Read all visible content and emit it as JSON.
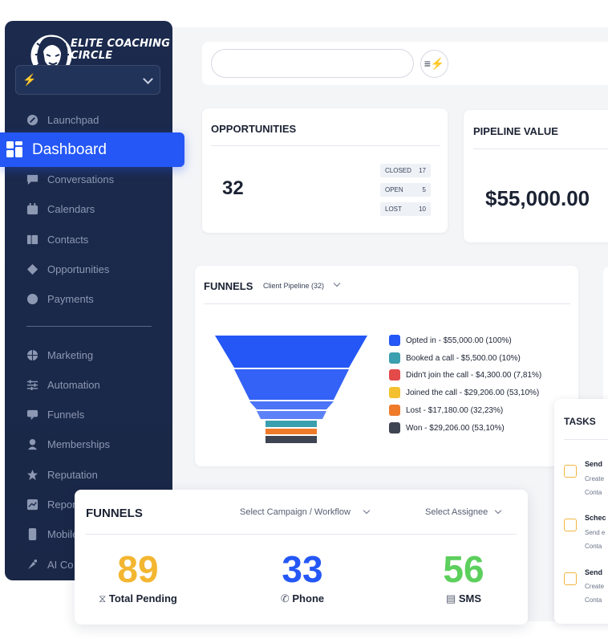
{
  "brand": {
    "name_line1": "ELITE COACHING",
    "name_line2": "CIRCLE"
  },
  "colors": {
    "accent": "#2457f5",
    "sidebar": "#1b2a4d",
    "orange": "#f3b630",
    "blue": "#2457f5",
    "green": "#5ccf5c"
  },
  "sidebar": {
    "items": [
      {
        "label": "Launchpad",
        "icon": "rocket-icon"
      },
      {
        "label": "Dashboard",
        "icon": "grid-icon",
        "active": true
      },
      {
        "label": "Conversations",
        "icon": "chat-icon"
      },
      {
        "label": "Calendars",
        "icon": "calendar-icon"
      },
      {
        "label": "Contacts",
        "icon": "contacts-icon"
      },
      {
        "label": "Opportunities",
        "icon": "opportunities-icon"
      },
      {
        "label": "Payments",
        "icon": "payments-icon"
      },
      {
        "label": "Marketing",
        "icon": "globe-icon"
      },
      {
        "label": "Automation",
        "icon": "sliders-icon"
      },
      {
        "label": "Funnels",
        "icon": "funnel-icon"
      },
      {
        "label": "Memberships",
        "icon": "membership-icon"
      },
      {
        "label": "Reputation",
        "icon": "star-icon"
      },
      {
        "label": "Repor",
        "icon": "reporting-icon"
      },
      {
        "label": "Mobile",
        "icon": "mobile-icon"
      },
      {
        "label": "AI Co",
        "icon": "ai-icon"
      }
    ]
  },
  "opportunities": {
    "title": "OPPORTUNITIES",
    "total": "32",
    "pills": [
      {
        "label": "CLOSED",
        "value": "17"
      },
      {
        "label": "OPEN",
        "value": "5"
      },
      {
        "label": "LOST",
        "value": "10"
      }
    ]
  },
  "pipeline": {
    "title": "PIPELINE VALUE",
    "value": "$55,000.00"
  },
  "funnels_chart": {
    "title": "FUNNELS",
    "selector": "Client Pipeline (32)",
    "legend": [
      {
        "label": "Opted in - $55,000.00 (100%)",
        "color": "#2457f5"
      },
      {
        "label": "Booked a call - $5,500.00 (10%)",
        "color": "#3a9fae"
      },
      {
        "label": "Didn't join the call - $4,300.00 (7,81%)",
        "color": "#e34a4a"
      },
      {
        "label": "Joined the call - $29,206.00 (53,10%)",
        "color": "#f3c130"
      },
      {
        "label": "Lost - $17,180.00 (32,23%)",
        "color": "#ef7a2a"
      },
      {
        "label": "Won - $29,206.00 (53,10%)",
        "color": "#3f4452"
      }
    ]
  },
  "tasks": {
    "title": "TASKS",
    "items": [
      {
        "title": "Send",
        "line1": "Create",
        "line2": "Conta"
      },
      {
        "title": "Schec",
        "line1": "Send e",
        "line2": "Conta"
      },
      {
        "title": "Send",
        "line1": "Create",
        "line2": "Conta"
      }
    ]
  },
  "funnels_stats": {
    "title": "FUNNELS",
    "campaign_select": "Select Campaign / Workflow",
    "assignee_select": "Select Assignee",
    "stats": [
      {
        "value": "89",
        "label": "Total Pending",
        "icon": "hourglass-icon"
      },
      {
        "value": "33",
        "label": "Phone",
        "icon": "phone-icon"
      },
      {
        "value": "56",
        "label": "SMS",
        "icon": "sms-icon"
      }
    ]
  }
}
